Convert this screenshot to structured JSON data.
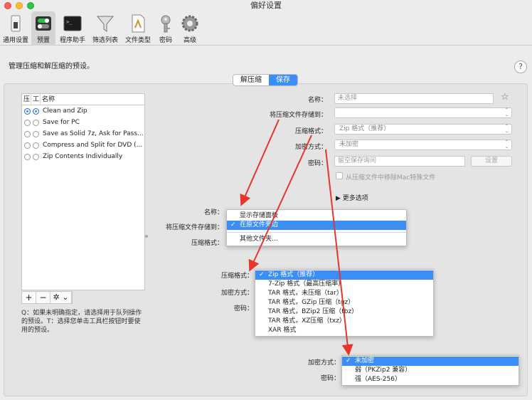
{
  "window": {
    "title": "偏好设置"
  },
  "toolbar": {
    "items": [
      {
        "label": "通用设置",
        "icon": "switch-icon"
      },
      {
        "label": "预置",
        "icon": "toggles-icon",
        "active": true
      },
      {
        "label": "程序助手",
        "icon": "terminal-icon"
      },
      {
        "label": "筛选列表",
        "icon": "funnel-icon"
      },
      {
        "label": "文件类型",
        "icon": "document-icon"
      },
      {
        "label": "密码",
        "icon": "key-icon"
      },
      {
        "label": "高级",
        "icon": "gear-icon"
      }
    ]
  },
  "description": "管理压缩和解压缩的预设。",
  "help": "?",
  "tabs": [
    {
      "label": "解压缩",
      "active": false
    },
    {
      "label": "保存",
      "active": true
    }
  ],
  "presets": {
    "headers": [
      "压",
      "工",
      "名称"
    ],
    "items": [
      {
        "label": "Clean and Zip",
        "col1": true,
        "col2": true
      },
      {
        "label": "Save for PC",
        "col1": false,
        "col2": false
      },
      {
        "label": "Save as Solid 7z, Ask for Pass...",
        "col1": false,
        "col2": false
      },
      {
        "label": "Compress and Split for DVD (...",
        "col1": false,
        "col2": false
      },
      {
        "label": "Zip Contents Individually",
        "col1": false,
        "col2": false
      }
    ],
    "tools": {
      "add": "+",
      "remove": "−",
      "gear": "✲ ⌄"
    },
    "note": "Q：如果未明确指定，请选择用于队列操作的预设。T：选择您单击工具栏按钮时要使用的预设。"
  },
  "form": {
    "name_label": "名称：",
    "name_placeholder": "未选择",
    "save_to_label": "将压缩文件存储到：",
    "format_label": "压缩格式：",
    "format_value": "Zip 格式（推荐）",
    "encryption_label": "加密方式：",
    "encryption_value": "未加密",
    "password_label": "密码：",
    "password_placeholder": "留空保存询问",
    "settings_button": "设置",
    "strip_mac_label": "从压缩文件中移除Mac特殊文件",
    "more_options": "▶ 更多选项"
  },
  "save_to_menu": {
    "name_label": "名称：",
    "save_to_label": "将压缩文件存储到：",
    "format_label": "压缩格式：",
    "items": [
      "显示存储面板",
      "在原文件旁边",
      "其他文件夹..."
    ],
    "selected": 1
  },
  "format_menu": {
    "format_label": "压缩格式：",
    "encryption_label": "加密方式：",
    "password_label": "密码：",
    "items": [
      "Zip 格式（推荐）",
      "7-Zip 格式（最高压缩率）",
      "TAR 格式，未压缩（tar）",
      "TAR 格式，GZip 压缩（tgz）",
      "TAR 格式，BZip2 压缩（tbz）",
      "TAR 格式，XZ压缩（txz）",
      "XAR 格式"
    ],
    "selected": 0
  },
  "encryption_menu": {
    "encryption_label": "加密方式：",
    "password_label": "密码：",
    "items": [
      "未加密",
      "弱（PKZip2 兼容）",
      "强（AES-256）"
    ],
    "selected": 0
  },
  "colors": {
    "accent": "#3a8ef6",
    "arrow": "#e8352b"
  }
}
